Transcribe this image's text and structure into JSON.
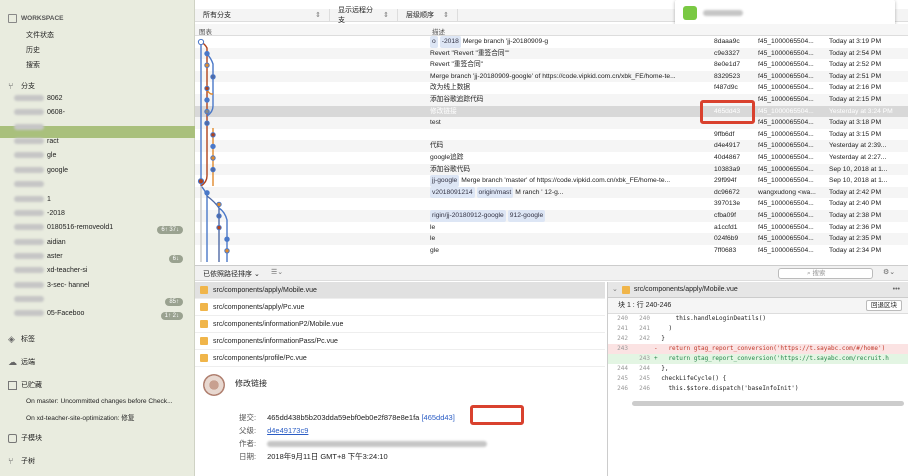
{
  "sidebar": {
    "workspace_label": "WORKSPACE",
    "file_status": "文件状态",
    "history": "历史",
    "search": "搜索",
    "branches_label": "分支",
    "branches": [
      {
        "label": "8062",
        "badge": ""
      },
      {
        "label": "0608-",
        "badge": ""
      },
      {
        "label": "",
        "badge": ""
      },
      {
        "label": "ract",
        "badge": ""
      },
      {
        "label": "gle",
        "badge": ""
      },
      {
        "label": "google",
        "badge": ""
      },
      {
        "label": "",
        "badge": ""
      },
      {
        "label": "1",
        "badge": ""
      },
      {
        "label": "-2018",
        "badge": ""
      },
      {
        "label": "0180516-removeold1",
        "badge": "6↑ 37↓"
      },
      {
        "label": "aidian",
        "badge": ""
      },
      {
        "label": "aster",
        "badge": "6↓"
      },
      {
        "label": "xd-teacher-si",
        "badge": ""
      },
      {
        "label": "3-sec-  hannel",
        "badge": ""
      },
      {
        "label": "",
        "badge": "85↑"
      },
      {
        "label": "05-Faceboo",
        "badge": "1↑ 2↓"
      }
    ],
    "tags_label": "标签",
    "remotes_label": "远端",
    "stashes_label": "已贮藏",
    "stashes": [
      "On master: Uncommitted changes before Check...",
      "On xd-teacher-site-optimization: 修复"
    ],
    "submodules_label": "子模块",
    "subtrees_label": "子树"
  },
  "topbar": {
    "branch_filter": "所有分支",
    "remote_filter": "显示远程分支",
    "order_filter": "层级顺序"
  },
  "columns": {
    "graph": "图表",
    "description": "描述"
  },
  "commits": [
    {
      "desc": "Merge branch 'jj-20180909-g",
      "tags": [
        "o",
        "-2018"
      ],
      "hash": "8daaa9c",
      "author": "f45_1000065504...",
      "date": "Today at 3:19 PM"
    },
    {
      "desc": "Revert \"Revert \"重签合同\"\"",
      "tags": [],
      "hash": "c9e3327",
      "author": "f45_1000065504...",
      "date": "Today at 2:54 PM"
    },
    {
      "desc": "Revert \"重签合同\"",
      "tags": [],
      "hash": "8e0e1d7",
      "author": "f45_1000065504...",
      "date": "Today at 2:52 PM"
    },
    {
      "desc": "Merge branch 'jj-20180909-google' of https://code.vipkid.com.cn/xbk_FE/home-te...",
      "tags": [],
      "hash": "8329523",
      "author": "f45_1000065504...",
      "date": "Today at 2:51 PM"
    },
    {
      "desc": "改为线上数据",
      "tags": [],
      "hash": "f487d9c",
      "author": "f45_1000065504...",
      "date": "Today at 2:16 PM"
    },
    {
      "desc": "添加谷歌追踪代码",
      "tags": [],
      "hash": "",
      "author": "f45_1000065504...",
      "date": "Today at 2:15 PM"
    },
    {
      "desc": "修改链接",
      "tags": [],
      "hash": "465dd43",
      "author": "f45_1000065504...",
      "date": "Yesterday at 3:24 PM"
    },
    {
      "desc": "test",
      "tags": [],
      "hash": "",
      "author": "f45_1000065504...",
      "date": "Today at 3:18 PM"
    },
    {
      "desc": "",
      "tags": [],
      "hash": "9ffb6df",
      "author": "f45_1000065504...",
      "date": "Today at 3:15 PM"
    },
    {
      "desc": "代码",
      "tags": [],
      "hash": "d4e4917",
      "author": "f45_1000065504...",
      "date": "Yesterday at 2:39..."
    },
    {
      "desc": "google追踪",
      "tags": [],
      "hash": "40d4867",
      "author": "f45_1000065504...",
      "date": "Yesterday at 2:27..."
    },
    {
      "desc": "添加谷歌代码",
      "tags": [],
      "hash": "10383a9",
      "author": "f45_1000065504...",
      "date": "Sep 10, 2018 at 1..."
    },
    {
      "desc": "Merge branch 'master' of https://code.vipkid.com.cn/xbk_FE/home-te...",
      "tags": [
        "jj-google"
      ],
      "hash": "29f994f",
      "author": "f45_1000065504...",
      "date": "Sep 10, 2018 at 1..."
    },
    {
      "desc": "M   ranch '         12-g...",
      "tags": [
        "v2018091214",
        "origin/mast"
      ],
      "hash": "dc96672",
      "author": "wangxudong <wa...",
      "date": "Today at 2:42 PM"
    },
    {
      "desc": "",
      "tags": [],
      "hash": "397013e",
      "author": "f45_1000065504...",
      "date": "Today at 2:40 PM"
    },
    {
      "desc": "",
      "tags": [
        "rigin/jj-20180912-google",
        "912-google"
      ],
      "hash": "cfba09f",
      "author": "f45_1000065504...",
      "date": "Today at 2:38 PM"
    },
    {
      "desc": "le",
      "tags": [],
      "hash": "a1ccfd1",
      "author": "f45_1000065504...",
      "date": "Today at 2:36 PM"
    },
    {
      "desc": "le",
      "tags": [],
      "hash": "024f6b9",
      "author": "f45_1000065504...",
      "date": "Today at 2:35 PM"
    },
    {
      "desc": "gle",
      "tags": [],
      "hash": "7ff0683",
      "author": "f45_1000065504...",
      "date": "Today at 2:34 PM"
    }
  ],
  "toolbar2": {
    "sort_label": "已依照路径排序",
    "search_placeholder": "搜索"
  },
  "files": [
    "src/components/apply/Mobile.vue",
    "src/components/apply/Pc.vue",
    "src/components/informationP2/Mobile.vue",
    "src/components/informationPass/Pc.vue",
    "src/components/profile/Pc.vue"
  ],
  "commit_detail": {
    "title": "修改链接",
    "commit_label": "提交:",
    "commit_full": "465dd438b5b203dda59ebf0eb0e2f878e8e1fa",
    "commit_short": "[465dd43]",
    "parent_label": "父级:",
    "parent": "d4e49173c9",
    "author_label": "作者:",
    "date_label": "日期:",
    "date": "2018年9月11日 GMT+8 下午3:24:10"
  },
  "diff": {
    "file": "src/components/apply/Mobile.vue",
    "chunk": "块 1 : 行 240-246",
    "discard_button": "回退区块",
    "lines": [
      {
        "a": "240",
        "b": "240",
        "type": "ctx",
        "text": "      this.handleLoginDeatils()"
      },
      {
        "a": "241",
        "b": "241",
        "type": "ctx",
        "text": "    )"
      },
      {
        "a": "242",
        "b": "242",
        "type": "ctx",
        "text": "  }"
      },
      {
        "a": "243",
        "b": "",
        "type": "del",
        "text": "-   return gtag_report_conversion('https://t.sayabc.com/#/home')"
      },
      {
        "a": "",
        "b": "243",
        "type": "add",
        "text": "+   return gtag_report_conversion('https://t.sayabc.com/recruit.h"
      },
      {
        "a": "244",
        "b": "244",
        "type": "ctx",
        "text": "  },"
      },
      {
        "a": "245",
        "b": "245",
        "type": "ctx",
        "text": "  checkLifeCycle() {"
      },
      {
        "a": "246",
        "b": "246",
        "type": "ctx",
        "text": "    this.$store.dispatch('baseInfoInit')"
      }
    ]
  }
}
